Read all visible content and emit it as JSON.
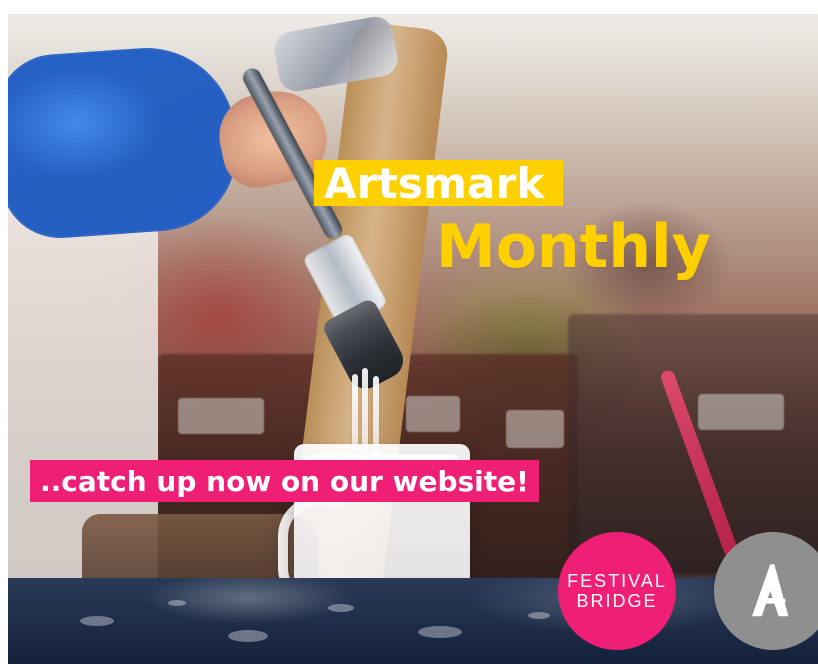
{
  "headline": {
    "line1": "Artsmark",
    "line2": "Monthly"
  },
  "cta": {
    "text": "..catch up now on our website!"
  },
  "logos": {
    "festival_bridge": [
      "FESTIVAL",
      "BRIDGE"
    ],
    "a_logo": "A"
  },
  "colors": {
    "yellow": "#ffd000",
    "pink": "#ef1f76",
    "grey": "#8f8f8f",
    "white": "#ffffff"
  }
}
